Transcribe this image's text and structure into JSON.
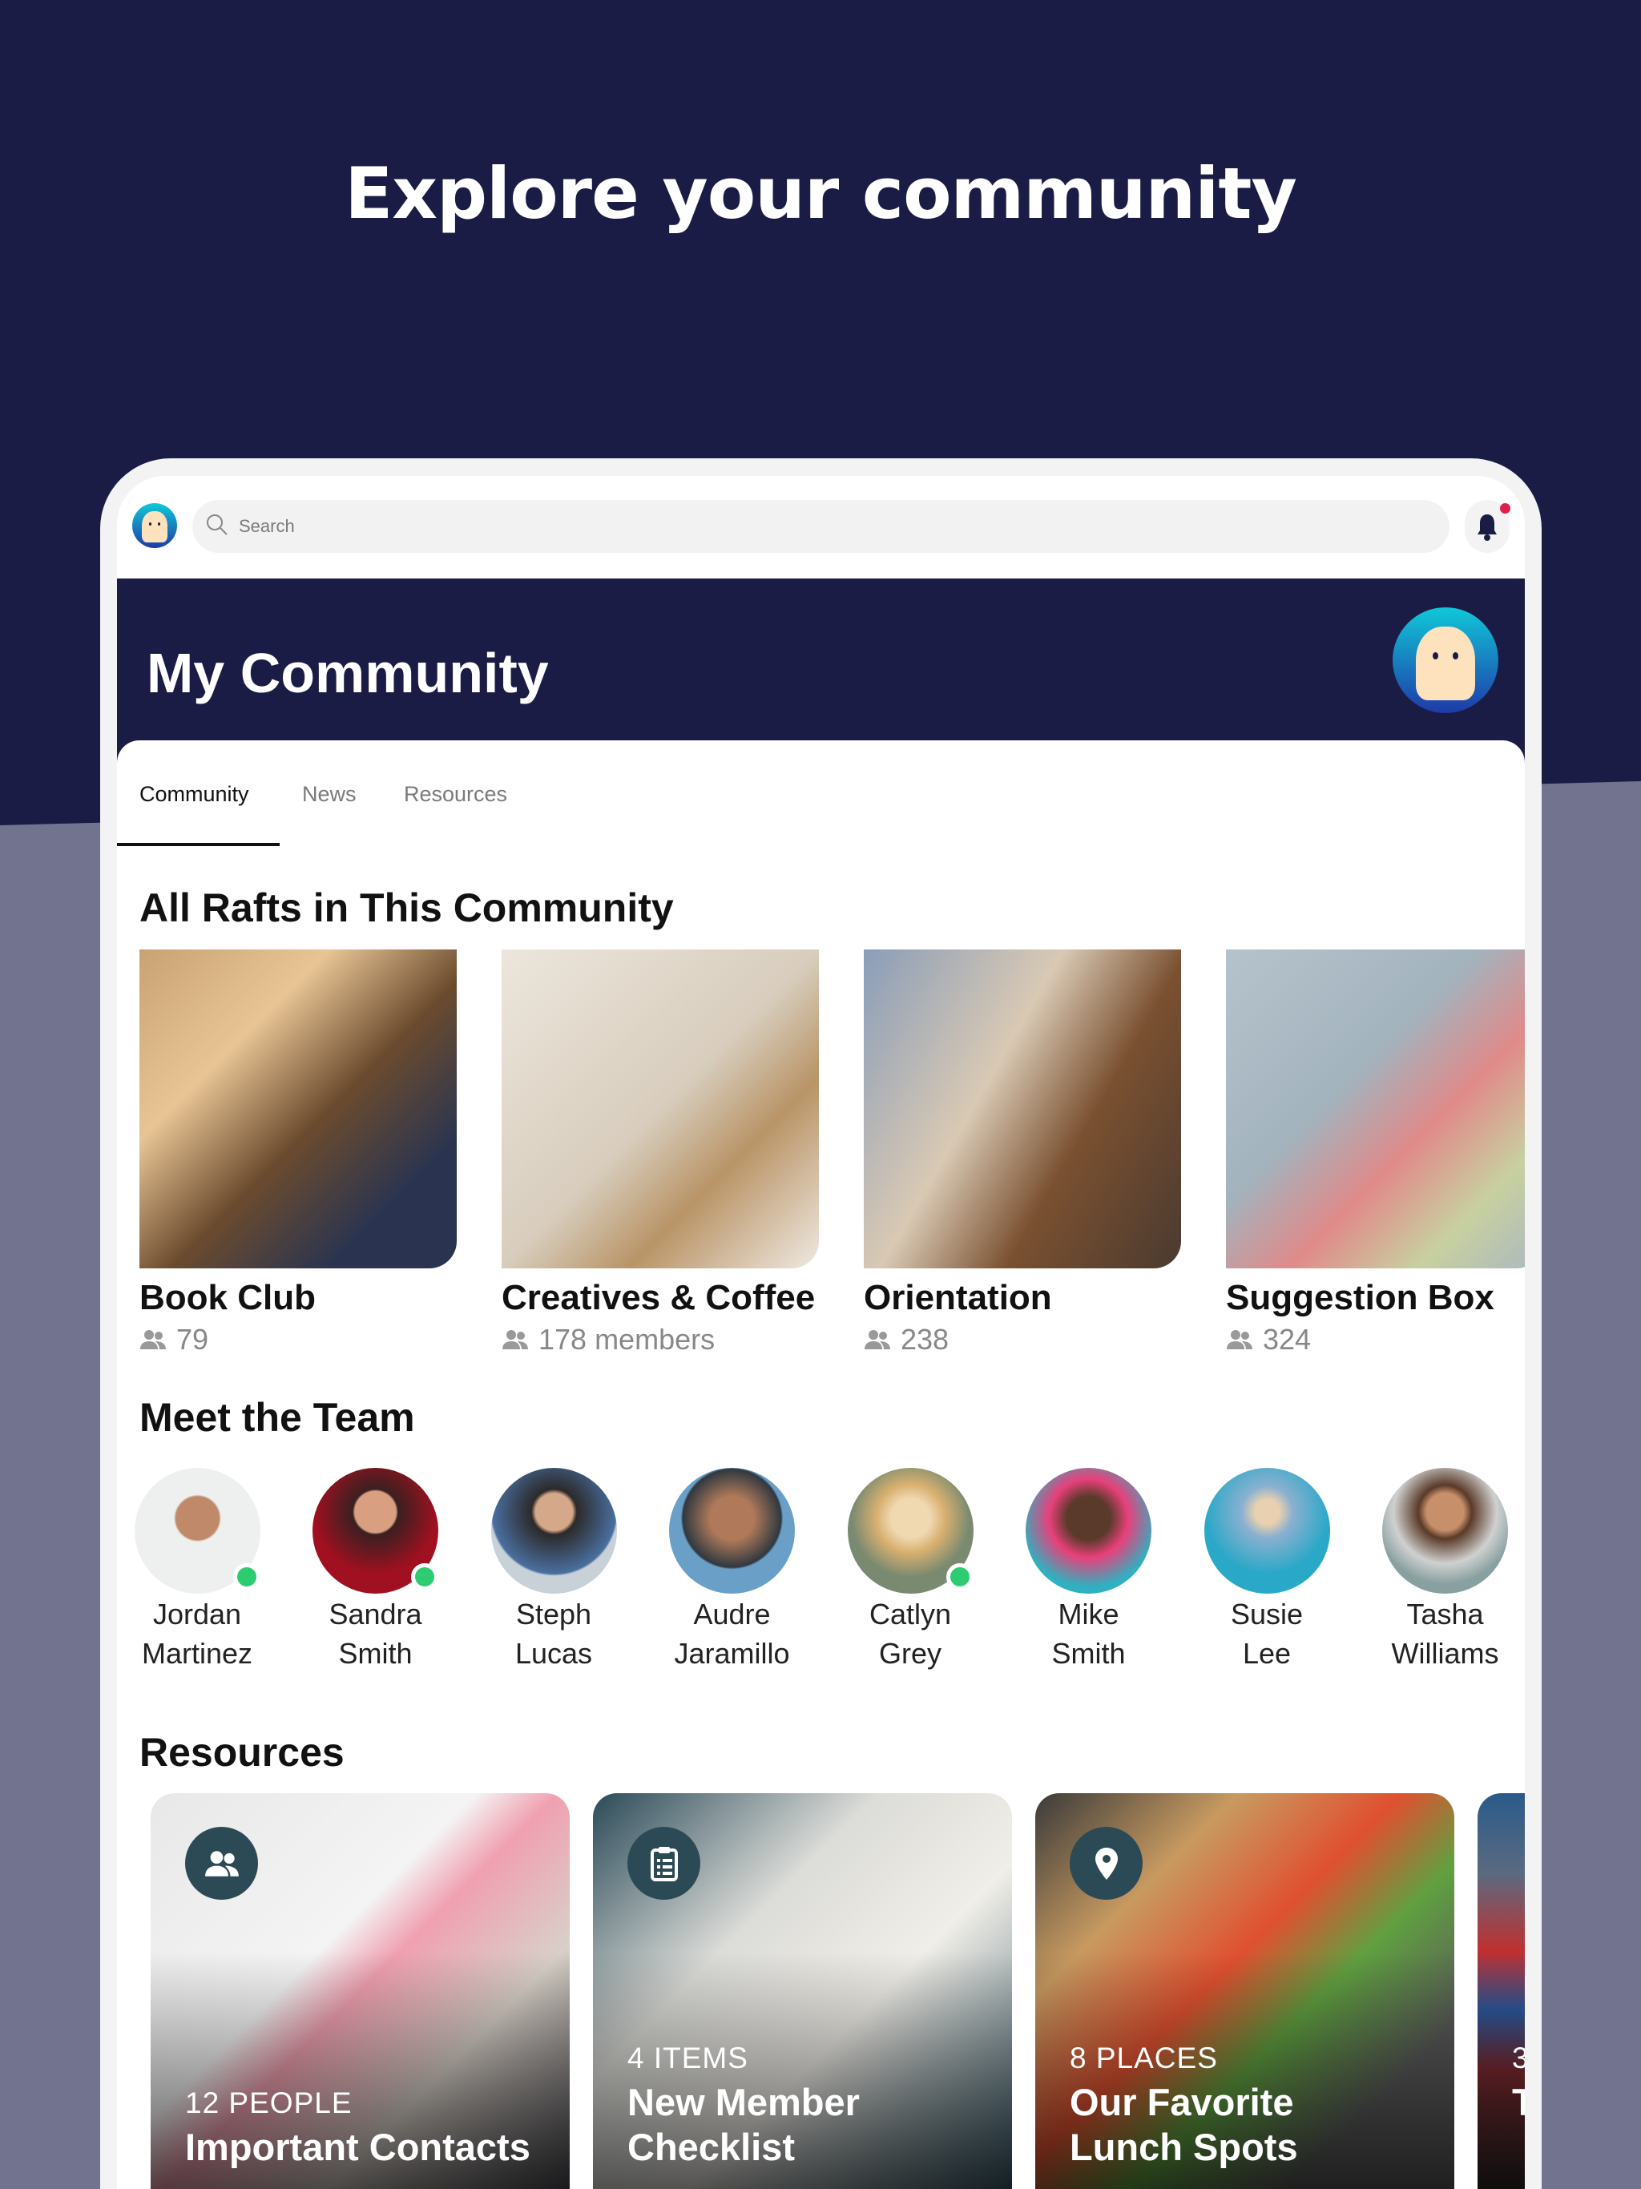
{
  "hero_title": "Explore your community",
  "colors": {
    "navy": "#1b1c45",
    "lavender": "#72748f",
    "online": "#2ecc71",
    "notification": "#e01e48"
  },
  "topbar": {
    "search_placeholder": "Search",
    "icons": [
      "app-avatar",
      "search-icon",
      "bell-icon"
    ]
  },
  "header": {
    "title": "My Community"
  },
  "tabs": [
    {
      "label": "Community",
      "active": true
    },
    {
      "label": "News"
    },
    {
      "label": "Resources"
    }
  ],
  "rafts_section": {
    "title": "All Rafts in This Community",
    "items": [
      {
        "title": "Book Club",
        "members": "79"
      },
      {
        "title": "Creatives & Coffee",
        "members": "178 members"
      },
      {
        "title": "Orientation",
        "members": "238"
      },
      {
        "title": "Suggestion Box",
        "members": "324"
      }
    ]
  },
  "team_section": {
    "title": "Meet the Team",
    "members": [
      {
        "first": "Jordan",
        "last": "Martinez",
        "online": true
      },
      {
        "first": "Sandra",
        "last": "Smith",
        "online": true
      },
      {
        "first": "Steph",
        "last": "Lucas",
        "online": false
      },
      {
        "first": "Audre",
        "last": "Jaramillo",
        "online": false
      },
      {
        "first": "Catlyn",
        "last": "Grey",
        "online": true
      },
      {
        "first": "Mike",
        "last": "Smith",
        "online": false
      },
      {
        "first": "Susie",
        "last": "Lee",
        "online": false
      },
      {
        "first": "Tasha",
        "last": "Williams",
        "online": false
      }
    ]
  },
  "resources_section": {
    "title": "Resources",
    "items": [
      {
        "count": "12 PEOPLE",
        "title": "Important Contacts",
        "icon": "people-icon"
      },
      {
        "count": "4 ITEMS",
        "title": "New Member Checklist",
        "icon": "checklist-icon"
      },
      {
        "count": "8 PLACES",
        "title": "Our Favorite Lunch Spots",
        "icon": "location-pin-icon"
      },
      {
        "count": "3",
        "title": "T"
      }
    ]
  }
}
